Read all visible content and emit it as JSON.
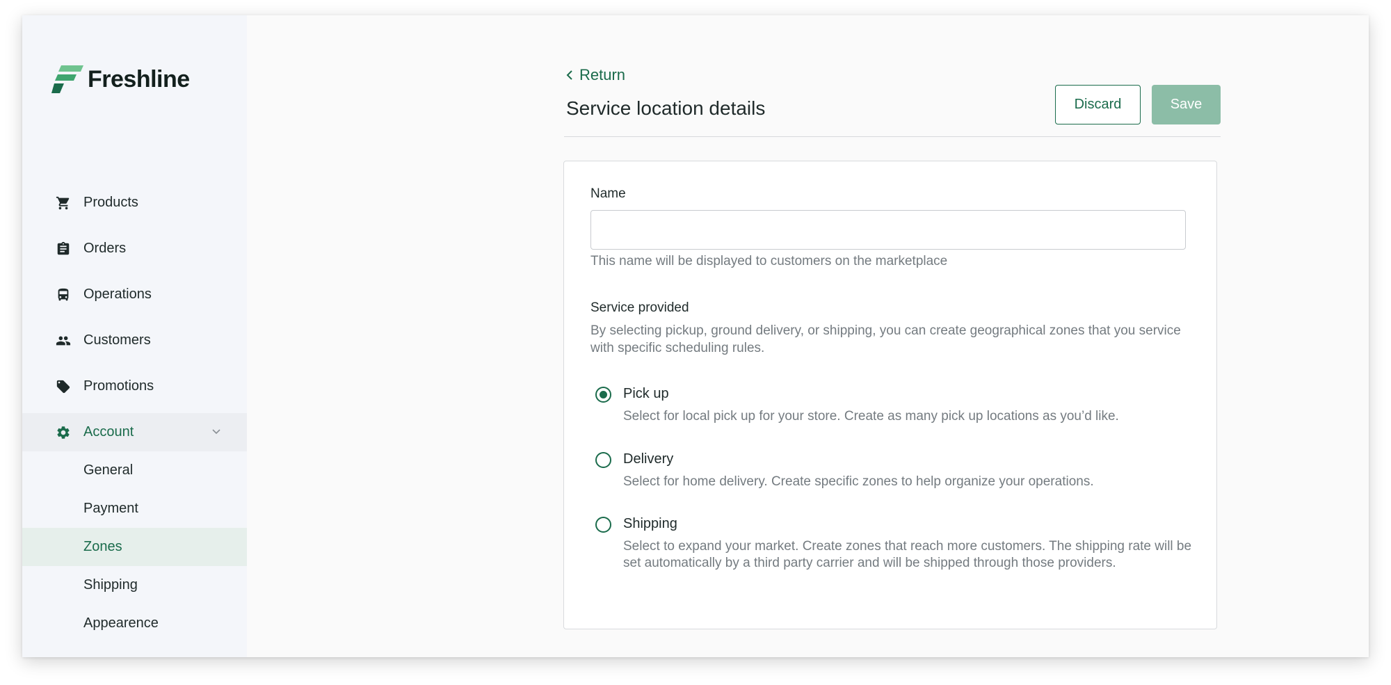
{
  "app": {
    "name": "Freshline",
    "brand_color": "#1a6b4b",
    "brand_light": "#3fa56f"
  },
  "sidebar": {
    "items": [
      {
        "label": "Products",
        "icon": "cart-icon"
      },
      {
        "label": "Orders",
        "icon": "clipboard-icon"
      },
      {
        "label": "Operations",
        "icon": "bus-icon"
      },
      {
        "label": "Customers",
        "icon": "people-icon"
      },
      {
        "label": "Promotions",
        "icon": "tag-icon"
      },
      {
        "label": "Account",
        "icon": "gear-icon",
        "expanded": true
      }
    ],
    "account_sub": [
      {
        "label": "General"
      },
      {
        "label": "Payment"
      },
      {
        "label": "Zones",
        "active": true
      },
      {
        "label": "Shipping"
      },
      {
        "label": "Appearence"
      }
    ]
  },
  "header": {
    "return_label": "Return",
    "title": "Service location details",
    "discard_label": "Discard",
    "save_label": "Save"
  },
  "form": {
    "name_label": "Name",
    "name_value": "",
    "name_help": "This name will be displayed to customers on the marketplace",
    "service_label": "Service provided",
    "service_desc": "By selecting pickup, ground delivery, or shipping, you can create geographical zones that you service with specific scheduling rules.",
    "options": [
      {
        "label": "Pick up",
        "desc": "Select for local pick up for your store. Create as many pick up locations as you’d like.",
        "checked": true
      },
      {
        "label": "Delivery",
        "desc": "Select for home delivery. Create specific zones to help organize your operations.",
        "checked": false
      },
      {
        "label": "Shipping",
        "desc": "Select to expand your market. Create zones that reach more customers. The shipping rate will be set automatically by a third party carrier and will be shipped through those providers.",
        "checked": false
      }
    ]
  }
}
